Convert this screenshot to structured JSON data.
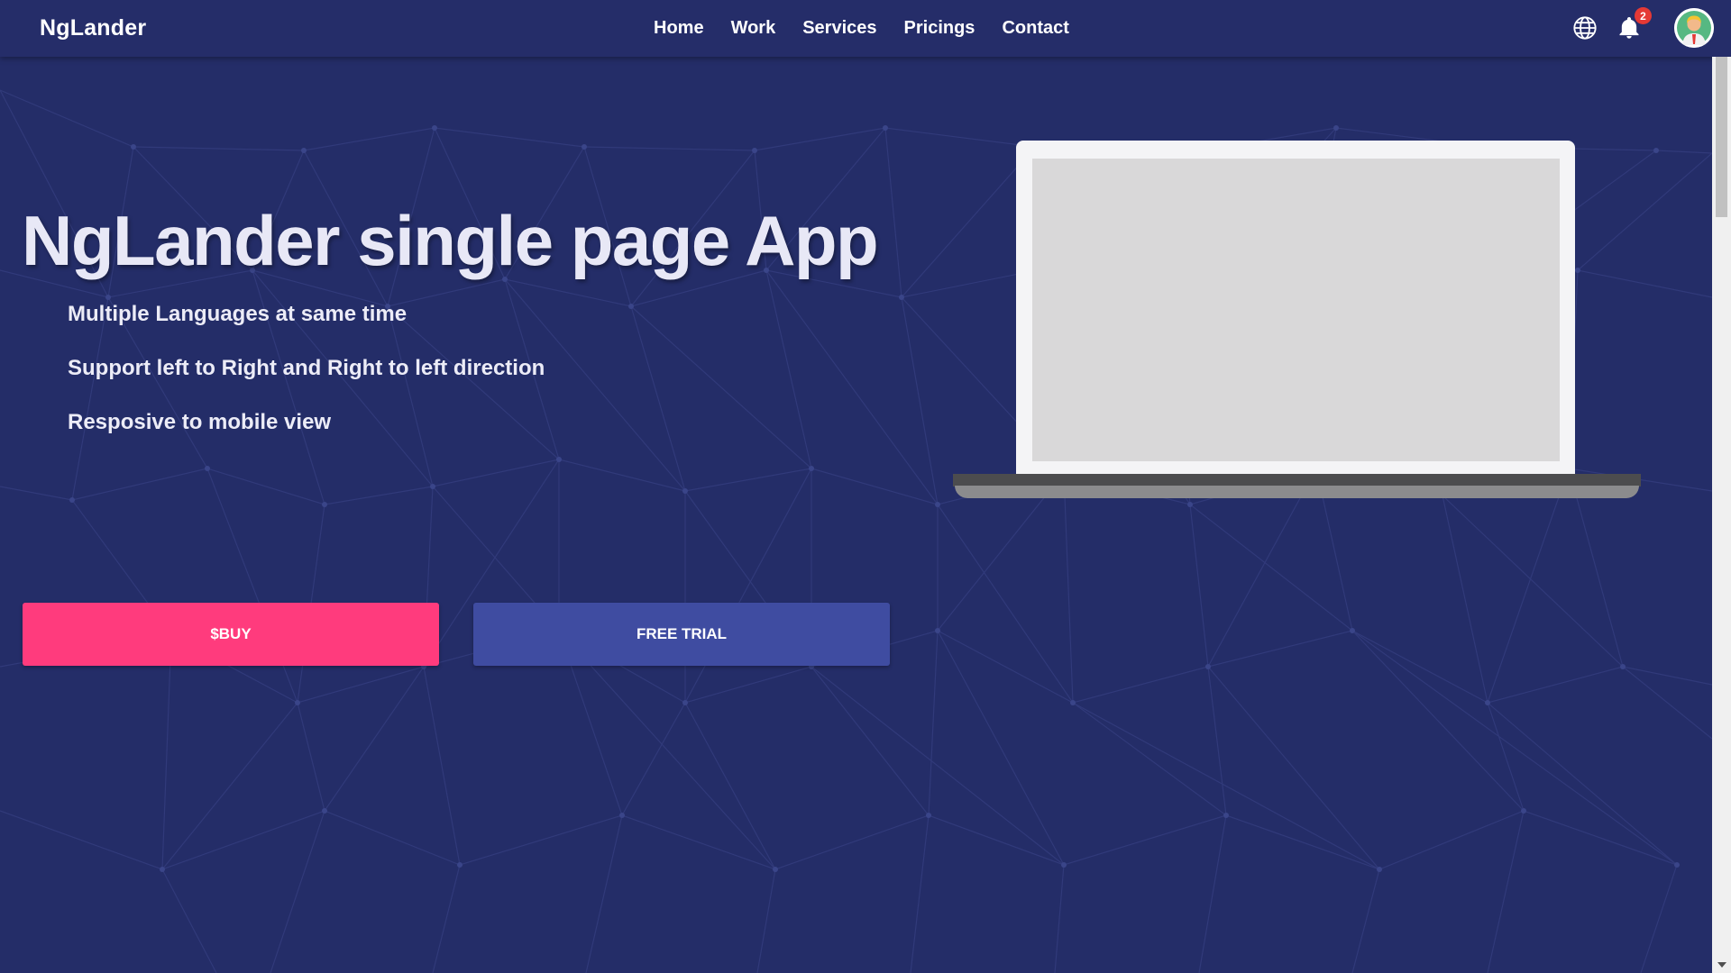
{
  "brand": "NgLander",
  "nav": {
    "items": [
      {
        "label": "Home"
      },
      {
        "label": "Work"
      },
      {
        "label": "Services"
      },
      {
        "label": "Pricings"
      },
      {
        "label": "Contact"
      }
    ]
  },
  "header_actions": {
    "language_icon": "globe-icon",
    "notifications_icon": "bell-icon",
    "notification_count": "2",
    "avatar_icon": "user-avatar"
  },
  "hero": {
    "title": "NgLander single page App",
    "features": [
      "Multiple Languages at same time",
      "Support left to Right and Right to left direction",
      "Resposive to mobile view"
    ],
    "buy_label": "$BUY",
    "trial_label": "FREE TRIAL"
  },
  "colors": {
    "background": "#242d68",
    "buy_button": "#ff3b7d",
    "trial_button": "#3f4ca1",
    "badge": "#e53935"
  }
}
